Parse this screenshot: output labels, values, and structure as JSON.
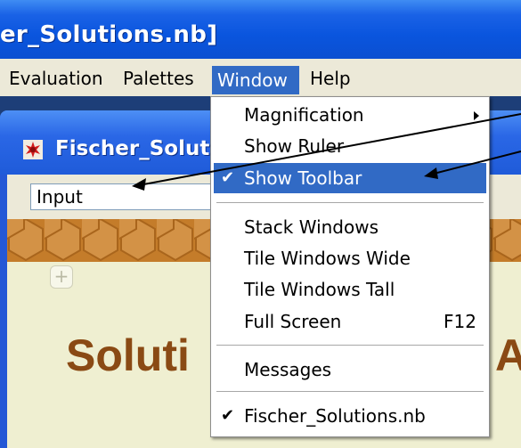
{
  "window": {
    "title": "er_Solutions.nb]"
  },
  "menubar": {
    "items": [
      {
        "label": "Evaluation"
      },
      {
        "label": "Palettes"
      },
      {
        "label": "Window"
      },
      {
        "label": "Help"
      }
    ]
  },
  "child_window": {
    "title": "Fischer_Solut"
  },
  "toolbar": {
    "style_value": "Input"
  },
  "notebook": {
    "add_cell_symbol": "+",
    "heading": "Soluti",
    "heading_right": "A"
  },
  "window_menu": {
    "items": [
      {
        "label": "Magnification"
      },
      {
        "label": "Show Ruler"
      },
      {
        "label": "Show Toolbar",
        "check": "✔"
      },
      {
        "label": "Stack Windows"
      },
      {
        "label": "Tile Windows Wide"
      },
      {
        "label": "Tile Windows Tall"
      },
      {
        "label": "Full Screen",
        "shortcut": "F12"
      },
      {
        "label": "Messages"
      },
      {
        "label": "Fischer_Solutions.nb",
        "check": "✔"
      }
    ]
  },
  "colors": {
    "title_blue": "#0a55de",
    "menu_bg": "#ece9d8",
    "highlight": "#316ac5",
    "heading_brown": "#8a4a14",
    "banner_orange": "#c98431",
    "content_bg": "#efefd1"
  },
  "icons": [
    "app-icon",
    "submenu-arrow-icon",
    "check-icon"
  ]
}
